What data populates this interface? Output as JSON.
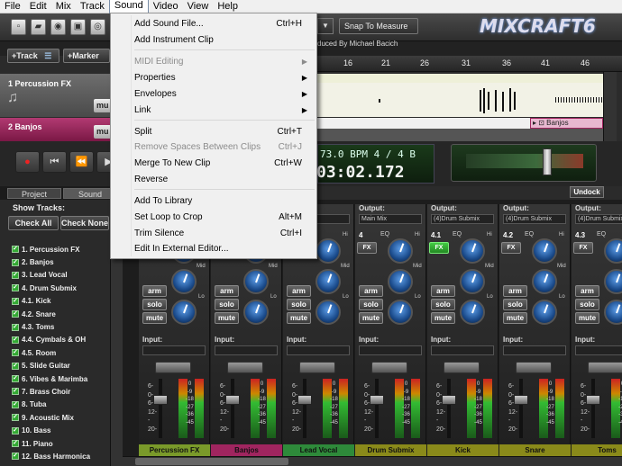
{
  "menubar": {
    "items": [
      {
        "label": "File"
      },
      {
        "label": "Edit"
      },
      {
        "label": "Mix"
      },
      {
        "label": "Track"
      },
      {
        "label": "Sound"
      },
      {
        "label": "Video"
      },
      {
        "label": "View"
      },
      {
        "label": "Help"
      }
    ]
  },
  "toolbar": {
    "snap_label": "Snap To Measure",
    "logo": "MIXCRAFT6"
  },
  "project": {
    "credit": "duced By Michael Bacich"
  },
  "track_buttons": {
    "add_track": "+Track",
    "add_marker": "+Marker"
  },
  "ruler": {
    "ticks": [
      "16",
      "21",
      "26",
      "31",
      "36",
      "41",
      "46"
    ]
  },
  "tracks": [
    {
      "name": "1 Percussion FX",
      "mute": "mu",
      "color": "#5a5a5a"
    },
    {
      "name": "2 Banjos",
      "mute": "mu",
      "color": "#a0255f"
    }
  ],
  "clip": {
    "label": "Banjos"
  },
  "transport": {
    "bpm": "73.0 BPM  4 / 4  B",
    "time": "03:02.172"
  },
  "panel_tabs": {
    "project": "Project",
    "sound": "Sound",
    "undock": "Undock"
  },
  "show_tracks": {
    "title": "Show Tracks:",
    "check_all": "Check All",
    "check_none": "Check None",
    "list": [
      "1. Percussion FX",
      "2. Banjos",
      "3. Lead Vocal",
      "4. Drum Submix",
      "4.1. Kick",
      "4.2. Snare",
      "4.3. Toms",
      "4.4. Cymbals & OH",
      "4.5. Room",
      "5. Slide Guitar",
      "6. Vibes & Marimba",
      "7. Brass Choir",
      "8. Tuba",
      "9. Acoustic Mix",
      "10. Bass",
      "11. Piano",
      "12. Bass Harmonica"
    ]
  },
  "mixer": {
    "labels": {
      "output": "Output:",
      "input": "Input:",
      "eq": "EQ",
      "fx": "FX",
      "arm": "arm",
      "solo": "solo",
      "mute": "mute",
      "hi": "Hi",
      "mid": "Mid",
      "lo": "Lo"
    },
    "scale": [
      "6-",
      "0-",
      "6-",
      "12-",
      "-",
      "20-"
    ],
    "db_marks": [
      "0",
      "-9",
      "-18",
      "-27",
      "-36",
      "-45"
    ],
    "strips": [
      {
        "name": "Percussion FX",
        "color": "#7a9a2a",
        "output": "",
        "num": "",
        "fx_on": false
      },
      {
        "name": "Banjos",
        "color": "#a0255f",
        "output": "",
        "num": "",
        "fx_on": false
      },
      {
        "name": "Lead Vocal",
        "color": "#2e8a3a",
        "output": "",
        "num": "",
        "fx_on": false
      },
      {
        "name": "Drum Submix",
        "color": "#8a8a1a",
        "output": "Main Mix",
        "num": "4",
        "fx_on": false
      },
      {
        "name": "Kick",
        "color": "#8a8a1a",
        "output": "(4)Drum Submix",
        "num": "4.1",
        "fx_on": true
      },
      {
        "name": "Snare",
        "color": "#8a8a1a",
        "output": "(4)Drum Submix",
        "num": "4.2",
        "fx_on": false
      },
      {
        "name": "Toms",
        "color": "#8a8a1a",
        "output": "(4)Drum Submix",
        "num": "4.3",
        "fx_on": false
      }
    ]
  },
  "sound_menu": {
    "items": [
      {
        "label": "Add Sound File...",
        "shortcut": "Ctrl+H",
        "disabled": false,
        "submenu": false
      },
      {
        "label": "Add Instrument Clip",
        "shortcut": "",
        "disabled": false,
        "submenu": false
      },
      {
        "label": "MIDI Editing",
        "shortcut": "",
        "disabled": true,
        "submenu": true
      },
      {
        "label": "Properties",
        "shortcut": "",
        "disabled": false,
        "submenu": true
      },
      {
        "label": "Envelopes",
        "shortcut": "",
        "disabled": false,
        "submenu": true
      },
      {
        "label": "Link",
        "shortcut": "",
        "disabled": false,
        "submenu": true
      },
      {
        "label": "Split",
        "shortcut": "Ctrl+T",
        "disabled": false,
        "submenu": false
      },
      {
        "label": "Remove Spaces Between Clips",
        "shortcut": "Ctrl+J",
        "disabled": true,
        "submenu": false
      },
      {
        "label": "Merge To New Clip",
        "shortcut": "Ctrl+W",
        "disabled": false,
        "submenu": false
      },
      {
        "label": "Reverse",
        "shortcut": "",
        "disabled": false,
        "submenu": false
      },
      {
        "label": "Add To Library",
        "shortcut": "",
        "disabled": false,
        "submenu": false
      },
      {
        "label": "Set Loop to Crop",
        "shortcut": "Alt+M",
        "disabled": false,
        "submenu": false
      },
      {
        "label": "Trim Silence",
        "shortcut": "Ctrl+I",
        "disabled": false,
        "submenu": false
      },
      {
        "label": "Edit In External Editor...",
        "shortcut": "",
        "disabled": false,
        "submenu": false
      }
    ]
  }
}
